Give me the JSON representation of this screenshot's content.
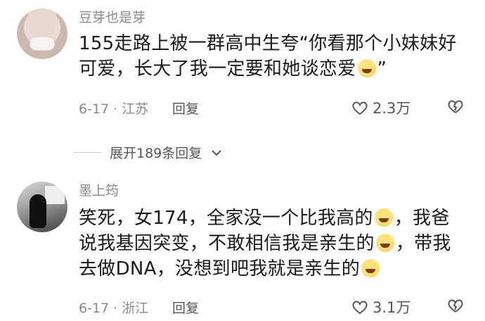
{
  "comments": [
    {
      "username": "豆芽也是芽",
      "text_part1": "155走路上被一群高中生夸“你看那个小妹妹好可爱，长大了我一定要和她谈恋爱",
      "text_part2": "”",
      "date_location": "6-17 · 江苏",
      "reply_label": "回复",
      "likes": "2.3万"
    },
    {
      "username": "墨上筠",
      "text_part1": "笑死，女174，全家没一个比我高的",
      "text_part2": "，我爸说我基因突变，不敢相信我是亲生的",
      "text_part3": "，带我去做DNA，没想到吧我就是亲生的",
      "date_location": "6-17 · 浙江",
      "reply_label": "回复",
      "likes": "3.1万"
    }
  ],
  "expand_replies": {
    "label": "展开189条回复"
  },
  "icons": {
    "like": "heart-outline-icon",
    "dislike": "broken-heart-icon",
    "expand": "chevron-down-icon"
  },
  "colors": {
    "text": "#1a1a1a",
    "meta": "#8a8a8a",
    "icon": "#555555"
  }
}
